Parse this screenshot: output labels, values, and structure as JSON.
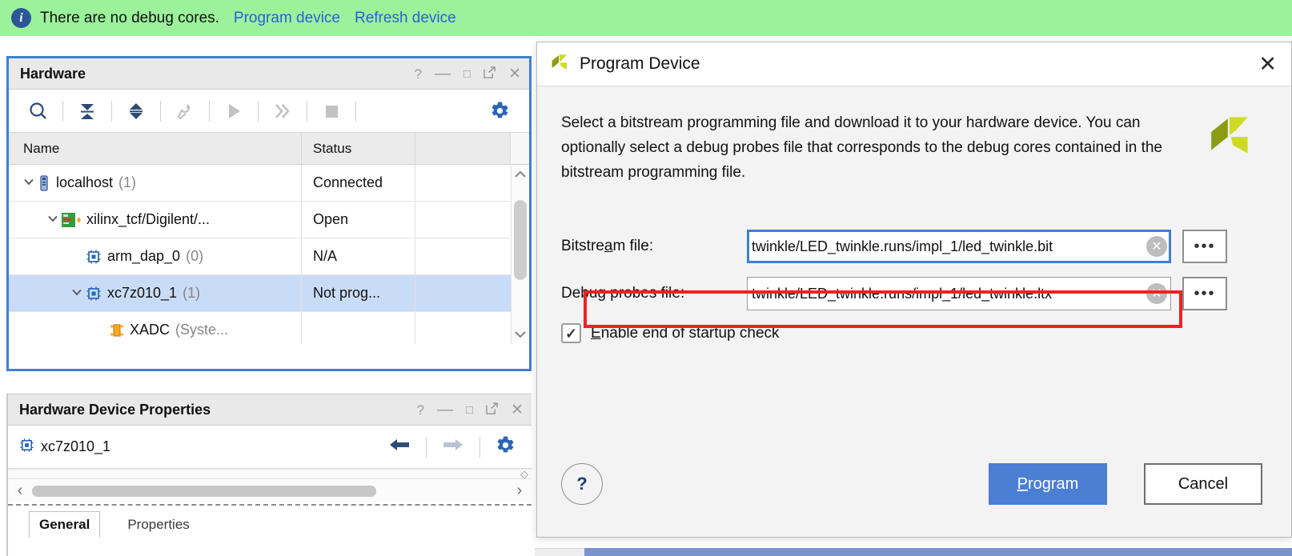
{
  "banner": {
    "icon": "info-icon",
    "message": "There are no debug cores.",
    "links": [
      "Program device",
      "Refresh device"
    ],
    "bg_color": "#9bf29b"
  },
  "hardware_panel": {
    "title": "Hardware",
    "header_buttons": [
      "?",
      "—",
      "□",
      "⇱",
      "✕"
    ],
    "toolbar_icons": [
      "search-icon",
      "collapse-all-icon",
      "expand-all-icon",
      "probe-icon",
      "run-icon",
      "step-icon",
      "stop-icon",
      "settings-gear-icon"
    ],
    "columns": [
      "Name",
      "Status"
    ],
    "rows": [
      {
        "name": "localhost",
        "count": "(1)",
        "status": "Connected",
        "indent": 0,
        "expanded": true,
        "icon": "server-icon",
        "selected": false
      },
      {
        "name": "xilinx_tcf/Digilent/...",
        "count": "",
        "status": "Open",
        "indent": 1,
        "expanded": true,
        "icon": "board-icon",
        "selected": false
      },
      {
        "name": "arm_dap_0",
        "count": "(0)",
        "status": "N/A",
        "indent": 2,
        "expanded": null,
        "icon": "chip-icon",
        "selected": false
      },
      {
        "name": "xc7z010_1",
        "count": "(1)",
        "status": "Not prog...",
        "indent": 2,
        "expanded": true,
        "icon": "chip-icon",
        "selected": true
      },
      {
        "name": "XADC",
        "count": "(Syste...",
        "status": "",
        "indent": 3,
        "expanded": null,
        "icon": "xadc-icon",
        "selected": false
      }
    ]
  },
  "device_properties_panel": {
    "title": "Hardware Device Properties",
    "header_buttons": [
      "?",
      "—",
      "□",
      "⇱",
      "✕"
    ],
    "device_name": "xc7z010_1",
    "nav_icons": [
      "back-arrow-icon",
      "forward-arrow-icon",
      "settings-gear-icon"
    ],
    "tabs": [
      {
        "label": "General",
        "active": true
      },
      {
        "label": "Properties",
        "active": false
      }
    ]
  },
  "dialog": {
    "title": "Program Device",
    "logo": "vivado-logo-icon",
    "close_label": "✕",
    "description": "Select a bitstream programming file and download it to your hardware device. You can optionally select a debug probes file that corresponds to the debug cores contained in the bitstream programming file.",
    "fields": [
      {
        "label": "Bitstream file:",
        "mnemonic": "m",
        "value": "twinkle/LED_twinkle.runs/impl_1/led_twinkle.bit",
        "focused": true,
        "highlighted": false,
        "browse_label": "•••",
        "clear_label": "✕"
      },
      {
        "label": "Debug probes file:",
        "mnemonic": "g",
        "value": "twinkle/LED_twinkle.runs/impl_1/led_twinkle.ltx",
        "focused": false,
        "highlighted": true,
        "browse_label": "•••",
        "clear_label": "✕"
      }
    ],
    "checkbox": {
      "label": "Enable end of startup check",
      "checked": true,
      "mnemonic": "E"
    },
    "help_label": "?",
    "buttons": [
      {
        "label": "Program",
        "primary": true,
        "mnemonic": "P"
      },
      {
        "label": "Cancel",
        "primary": false,
        "mnemonic": ""
      }
    ],
    "highlight_color": "#f32020",
    "primary_color": "#4a7fd4"
  }
}
